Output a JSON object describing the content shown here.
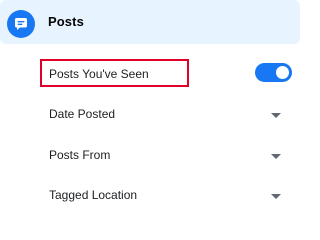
{
  "colors": {
    "accent": "#1877f2",
    "header_background": "#e7f3ff",
    "highlight_border": "#e0002a"
  },
  "header": {
    "label": "Posts",
    "icon": "chat-bubble-icon"
  },
  "filters": [
    {
      "label": "Posts You've Seen",
      "control": "toggle",
      "toggle_on": true
    },
    {
      "label": "Date Posted",
      "control": "dropdown",
      "icon": "caret-down-icon"
    },
    {
      "label": "Posts From",
      "control": "dropdown",
      "icon": "caret-down-icon"
    },
    {
      "label": "Tagged Location",
      "control": "dropdown",
      "icon": "caret-down-icon"
    }
  ]
}
